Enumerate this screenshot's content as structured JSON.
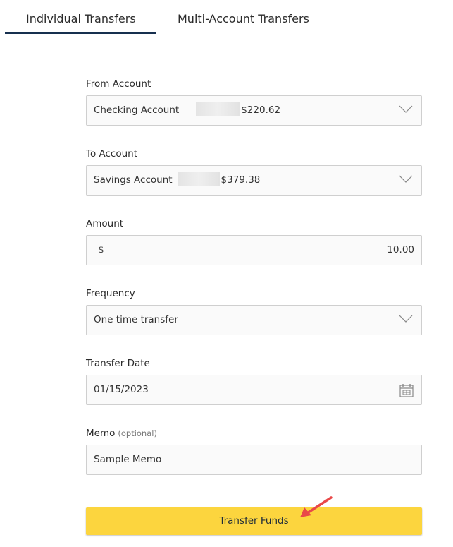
{
  "tabs": {
    "individual": "Individual Transfers",
    "multi": "Multi-Account Transfers",
    "active": "Individual Transfers"
  },
  "form": {
    "from_account": {
      "label": "From Account",
      "name": "Checking Account",
      "balance": "$220.62",
      "icon": "chevron-down-icon"
    },
    "to_account": {
      "label": "To Account",
      "name": "Savings Account",
      "balance": "$379.38",
      "icon": "chevron-down-icon"
    },
    "amount": {
      "label": "Amount",
      "prefix": "$",
      "value": "10.00"
    },
    "frequency": {
      "label": "Frequency",
      "value": "One time transfer",
      "icon": "chevron-down-icon"
    },
    "transfer_date": {
      "label": "Transfer Date",
      "value": "01/15/2023",
      "icon": "calendar-icon"
    },
    "memo": {
      "label": "Memo",
      "optional": "(optional)",
      "value": "Sample Memo"
    },
    "submit_label": "Transfer Funds"
  },
  "colors": {
    "accent_tab": "#17304f",
    "button": "#fcd53e",
    "annotation_arrow": "#e94848"
  }
}
